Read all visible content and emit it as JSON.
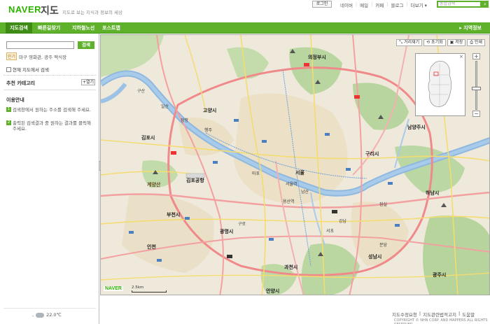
{
  "header": {
    "logo": "NAVER",
    "logo_sub": "지도",
    "tagline": "지도로 보는 지식과 정보의 세상",
    "login": "로그인",
    "top_links": [
      "네이버",
      "메일",
      "카페",
      "블로그",
      "더보기"
    ],
    "top_search_placeholder": "통합검색"
  },
  "nav": {
    "items": [
      "지도검색",
      "빠른길찾기",
      "지하철노선",
      "포스트맵"
    ],
    "right": "지역정보",
    "accent": "#5fb12b"
  },
  "left_panel": {
    "search_button": "검색",
    "example_badge": "인기",
    "example_text": "마구 영화관, 광주 맥식장",
    "current_map_search": "현재 지도에서 검색",
    "category_title": "추천 카테고리",
    "category_open": "열기",
    "guide_title": "이용안내",
    "guide_items": [
      {
        "num": "1",
        "text": "검색창에서 원하는 주소를 검색해 주세요."
      },
      {
        "num": "2",
        "text": "출력된 검색결과 중 원하는 결과를 클릭해 주세요."
      }
    ],
    "weather": "22.0℃"
  },
  "map": {
    "toolbar": [
      "거리재기",
      "초기화",
      "저장",
      "인쇄"
    ],
    "logo": "NAVER",
    "scale": "2.5km",
    "labels": {
      "uijeongbu": "의정부시",
      "goyang": "고양시",
      "gimpo": "김포시",
      "gimpo_airport": "김포공항",
      "seoul": "서울",
      "seoul_station": "서울역",
      "yongsan": "용산역",
      "bucheon": "부천시",
      "gwangmyeong": "광명시",
      "incheon": "인천",
      "gwacheon": "과천시",
      "anyang": "안양시",
      "seongnam": "성남시",
      "guri": "구리시",
      "namyangju": "남양주시",
      "hanam": "하남시",
      "gwangju": "광주시",
      "guro": "구로",
      "gangnam": "강남",
      "seocho": "서초",
      "gyeyang": "계양산",
      "paju": "구산",
      "ilsan": "일산",
      "jugyo": "장항",
      "haengju": "행주",
      "mapo": "마포",
      "namsan": "남산",
      "jamsil": "잠실",
      "bundang": "분당"
    }
  },
  "footer": {
    "links": [
      "지도수정요청",
      "지도관련법적고지",
      "도움말"
    ],
    "copyright": "COPYRIGHT © NHN CORP. AND MAPPERS ALL RIGHTS RESERVED."
  }
}
